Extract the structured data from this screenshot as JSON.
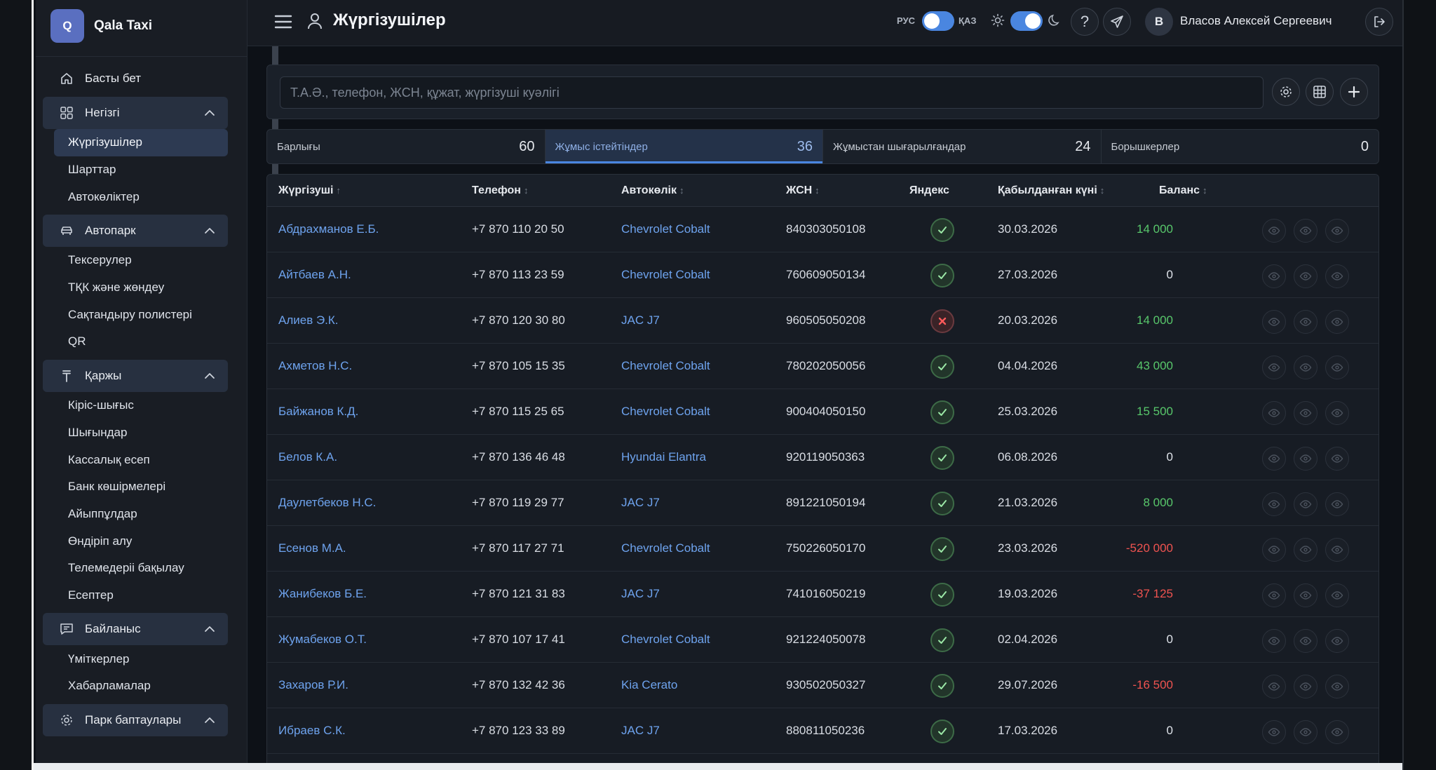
{
  "brand": {
    "logo_letter": "Q",
    "name": "Qala Taxi"
  },
  "sidebar": {
    "home": {
      "label": "Басты бет",
      "icon": "home-icon"
    },
    "groups": [
      {
        "label": "Негізгі",
        "icon": "dashboard-icon",
        "items": [
          "Жүргізушілер",
          "Шарттар",
          "Автокөліктер"
        ],
        "active_item": 0
      },
      {
        "label": "Автопарк",
        "icon": "car-icon",
        "items": [
          "Тексерулер",
          "ТҚК және жөндеу",
          "Сақтандыру полистері",
          "QR"
        ]
      },
      {
        "label": "Қаржы",
        "icon": "tenge-icon",
        "items": [
          "Кіріс-шығыс",
          "Шығындар",
          "Кассалық есеп",
          "Банк көшірмелері",
          "Айыппұлдар",
          "Өндіріп алу",
          "Телемедеріі бақылау",
          "Есептер"
        ]
      },
      {
        "label": "Байланыс",
        "icon": "message-icon",
        "items": [
          "Үміткерлер",
          "Хабарламалар"
        ]
      },
      {
        "label": "Парк баптаулары",
        "icon": "gear-icon",
        "items": []
      }
    ]
  },
  "topbar": {
    "title": "Жүргізушілер",
    "lang_left": "РУС",
    "lang_right": "ҚАЗ",
    "help_symbol": "?",
    "avatar_letter": "В",
    "user_name": "Власов Алексей Сергеевич"
  },
  "search": {
    "placeholder": "Т.А.Ә., телефон, ЖСН, құжат, жүргізуші куәлігі",
    "value": ""
  },
  "tabs": [
    {
      "label": "Барлығы",
      "count": "60"
    },
    {
      "label": "Жұмыс істейтіндер",
      "count": "36",
      "active": true
    },
    {
      "label": "Жұмыстан шығарылғандар",
      "count": "24"
    },
    {
      "label": "Борышкерлер",
      "count": "0"
    }
  ],
  "table": {
    "headers": {
      "driver": "Жүргізуші",
      "phone": "Телефон",
      "car": "Автокөлік",
      "iin": "ЖСН",
      "yandex": "Яндекс",
      "hired": "Қабылданған күні",
      "balance": "Баланс"
    },
    "sort_asc_symbol": "↑",
    "sort_symbol": "↕",
    "rows": [
      {
        "driver": "Абдрахманов Е.Б.",
        "phone": "+7 870 110 20 50",
        "car": "Chevrolet Cobalt",
        "iin": "840303050108",
        "yandex": true,
        "hired": "30.03.2026",
        "balance": "14 000",
        "balance_sign": "pos"
      },
      {
        "driver": "Айтбаев А.Н.",
        "phone": "+7 870 113 23 59",
        "car": "Chevrolet Cobalt",
        "iin": "760609050134",
        "yandex": true,
        "hired": "27.03.2026",
        "balance": "0",
        "balance_sign": "zero"
      },
      {
        "driver": "Алиев Э.К.",
        "phone": "+7 870 120 30 80",
        "car": "JAC J7",
        "iin": "960505050208",
        "yandex": false,
        "hired": "20.03.2026",
        "balance": "14 000",
        "balance_sign": "pos"
      },
      {
        "driver": "Ахметов Н.С.",
        "phone": "+7 870 105 15 35",
        "car": "Chevrolet Cobalt",
        "iin": "780202050056",
        "yandex": true,
        "hired": "04.04.2026",
        "balance": "43 000",
        "balance_sign": "pos"
      },
      {
        "driver": "Байжанов К.Д.",
        "phone": "+7 870 115 25 65",
        "car": "Chevrolet Cobalt",
        "iin": "900404050150",
        "yandex": true,
        "hired": "25.03.2026",
        "balance": "15 500",
        "balance_sign": "pos"
      },
      {
        "driver": "Белов К.А.",
        "phone": "+7 870 136 46 48",
        "car": "Hyundai Elantra",
        "iin": "920119050363",
        "yandex": true,
        "hired": "06.08.2026",
        "balance": "0",
        "balance_sign": "zero"
      },
      {
        "driver": "Даулетбеков Н.С.",
        "phone": "+7 870 119 29 77",
        "car": "JAC J7",
        "iin": "891221050194",
        "yandex": true,
        "hired": "21.03.2026",
        "balance": "8 000",
        "balance_sign": "pos"
      },
      {
        "driver": "Есенов М.А.",
        "phone": "+7 870 117 27 71",
        "car": "Chevrolet Cobalt",
        "iin": "750226050170",
        "yandex": true,
        "hired": "23.03.2026",
        "balance": "-520 000",
        "balance_sign": "neg"
      },
      {
        "driver": "Жанибеков Б.Е.",
        "phone": "+7 870 121 31 83",
        "car": "JAC J7",
        "iin": "741016050219",
        "yandex": true,
        "hired": "19.03.2026",
        "balance": "-37 125",
        "balance_sign": "neg"
      },
      {
        "driver": "Жумабеков О.Т.",
        "phone": "+7 870 107 17 41",
        "car": "Chevrolet Cobalt",
        "iin": "921224050078",
        "yandex": true,
        "hired": "02.04.2026",
        "balance": "0",
        "balance_sign": "zero"
      },
      {
        "driver": "Захаров Р.И.",
        "phone": "+7 870 132 42 36",
        "car": "Kia Cerato",
        "iin": "930502050327",
        "yandex": true,
        "hired": "29.07.2026",
        "balance": "-16 500",
        "balance_sign": "neg"
      },
      {
        "driver": "Ибраев С.К.",
        "phone": "+7 870 123 33 89",
        "car": "JAC J7",
        "iin": "880811050236",
        "yandex": true,
        "hired": "17.03.2026",
        "balance": "0",
        "balance_sign": "zero"
      }
    ]
  },
  "colors": {
    "accent": "#4a86e0",
    "link": "#6ea3ee",
    "positive": "#58c76b",
    "negative": "#ef5350"
  }
}
